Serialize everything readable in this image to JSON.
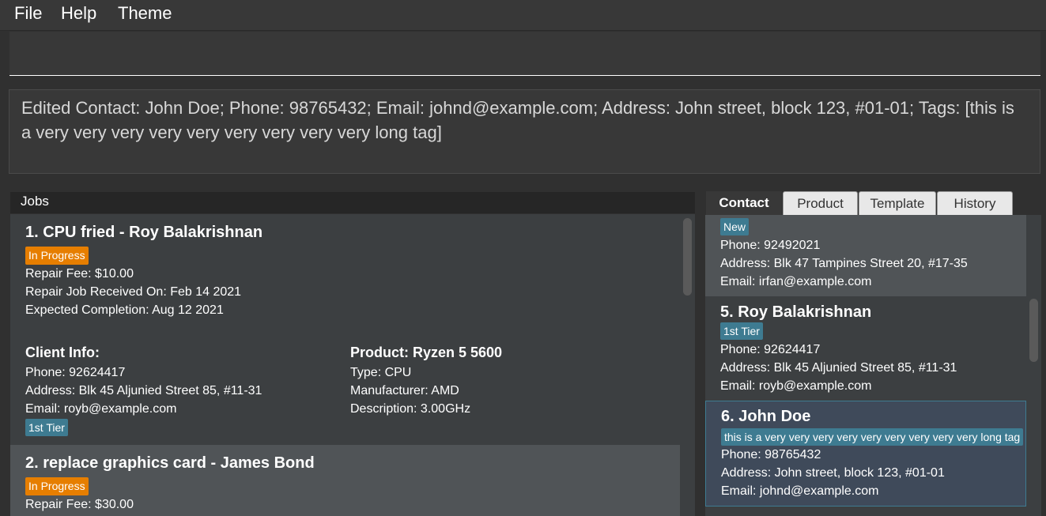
{
  "menu": {
    "file": "File",
    "help": "Help",
    "theme": "Theme"
  },
  "command_box": {
    "value": ""
  },
  "result_display": {
    "text": "Edited Contact: John Doe; Phone: 98765432; Email: johnd@example.com; Address: John street, block 123, #01-01; Tags: [this is a very very very very very very very very very long tag]"
  },
  "jobs": {
    "title": "Jobs",
    "items": [
      {
        "title": "1. CPU fried - Roy Balakrishnan",
        "status": "In Progress",
        "repair_fee": "Repair Fee: $10.00",
        "received": "Repair Job Received On: Feb 14 2021",
        "expected": "Expected Completion: Aug 12 2021",
        "client_heading": "Client Info:",
        "client_phone": "Phone: 92624417",
        "client_address": "Address: Blk 45 Aljunied Street 85, #11-31",
        "client_email": "Email: royb@example.com",
        "client_tag": "1st Tier",
        "product_heading": "Product: Ryzen 5 5600",
        "product_type": "Type: CPU",
        "product_manufacturer": "Manufacturer: AMD",
        "product_description": "Description: 3.00GHz"
      },
      {
        "title": "2. replace graphics card - James Bond",
        "status": "In Progress",
        "repair_fee": "Repair Fee: $30.00"
      }
    ]
  },
  "tabs": {
    "contact": "Contact",
    "product": "Product",
    "template": "Template",
    "history": "History"
  },
  "contacts": {
    "items": [
      {
        "tag": "New",
        "phone": "Phone: 92492021",
        "address": "Address: Blk 47 Tampines Street 20, #17-35",
        "email": "Email: irfan@example.com"
      },
      {
        "name": "5.  Roy Balakrishnan",
        "tag": "1st Tier",
        "phone": "Phone: 92624417",
        "address": "Address: Blk 45 Aljunied Street 85, #11-31",
        "email": "Email: royb@example.com"
      },
      {
        "name": "6.  John Doe",
        "tag": "this is a very very very very very very very very very long tag",
        "phone": "Phone: 98765432",
        "address": "Address: John street, block 123, #01-01",
        "email": "Email: johnd@example.com"
      }
    ]
  },
  "colors": {
    "status_in_progress": "#e67e00",
    "tag": "#3e7b91",
    "selected_border": "#3e7b91"
  }
}
